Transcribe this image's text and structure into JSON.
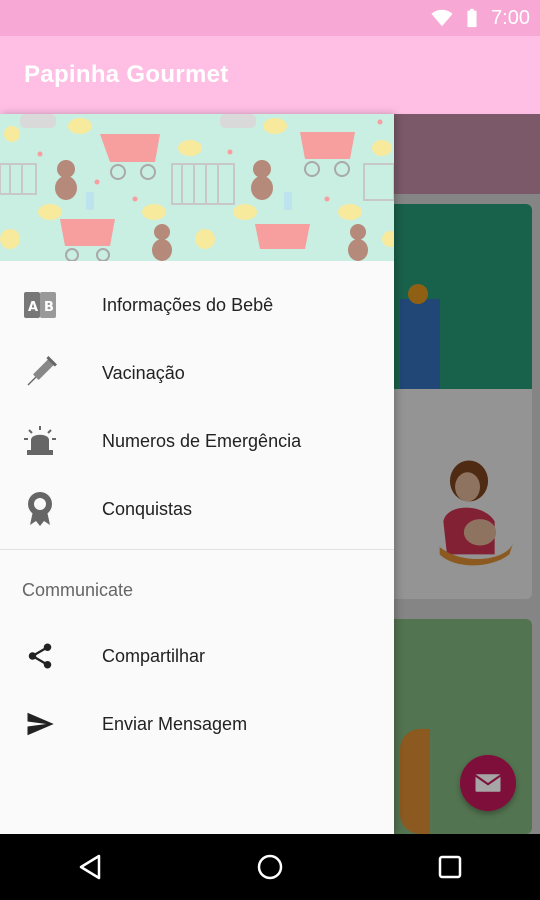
{
  "status_bar": {
    "time": "7:00"
  },
  "app_bar": {
    "title": "Papinha Gourmet"
  },
  "drawer": {
    "items": [
      {
        "label": "Informações do Bebê",
        "icon": "abc-blocks-icon"
      },
      {
        "label": "Vacinação",
        "icon": "syringe-icon"
      },
      {
        "label": "Numeros de Emergência",
        "icon": "siren-icon"
      },
      {
        "label": "Conquistas",
        "icon": "award-icon"
      }
    ],
    "section_title": "Communicate",
    "communicate_items": [
      {
        "label": "Compartilhar",
        "icon": "share-icon"
      },
      {
        "label": "Enviar Mensagem",
        "icon": "send-icon"
      }
    ]
  },
  "colors": {
    "status_bar": "#f8a8d5",
    "app_bar": "#ffbfe4",
    "header_bg": "#c9eee2",
    "fab": "#c2185b"
  }
}
